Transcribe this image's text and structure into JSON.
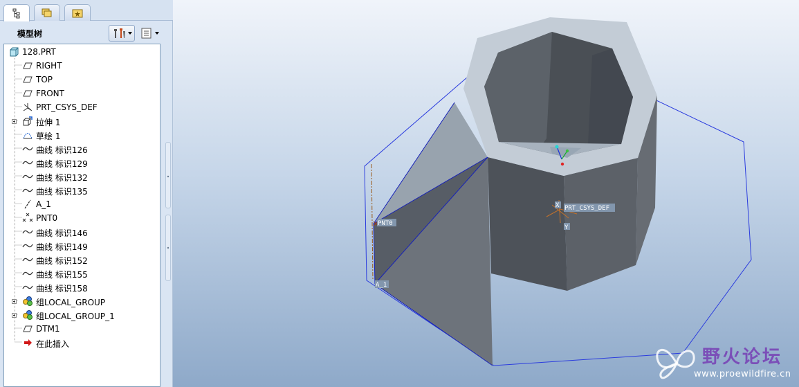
{
  "panel": {
    "title": "模型树",
    "tabs": [
      {
        "name": "model-tree-tab",
        "icon": "tree-icon"
      },
      {
        "name": "folder-browser-tab",
        "icon": "folders-icon"
      },
      {
        "name": "favorites-tab",
        "icon": "star-folder-icon"
      }
    ],
    "settings_icon": "settings-tools-icon",
    "show_icon": "show-list-icon"
  },
  "tree": {
    "root": "128.PRT",
    "items": [
      {
        "label": "RIGHT",
        "icon": "datum-plane-icon",
        "expandable": false
      },
      {
        "label": "TOP",
        "icon": "datum-plane-icon",
        "expandable": false
      },
      {
        "label": "FRONT",
        "icon": "datum-plane-icon",
        "expandable": false
      },
      {
        "label": "PRT_CSYS_DEF",
        "icon": "csys-icon",
        "expandable": false
      },
      {
        "label": "拉伸 1",
        "icon": "extrude-icon",
        "expandable": true
      },
      {
        "label": "草绘 1",
        "icon": "sketch-icon",
        "expandable": false
      },
      {
        "label": "曲线 标识126",
        "icon": "curve-icon",
        "expandable": false
      },
      {
        "label": "曲线 标识129",
        "icon": "curve-icon",
        "expandable": false
      },
      {
        "label": "曲线 标识132",
        "icon": "curve-icon",
        "expandable": false
      },
      {
        "label": "曲线 标识135",
        "icon": "curve-icon",
        "expandable": false
      },
      {
        "label": "A_1",
        "icon": "datum-axis-icon",
        "expandable": false
      },
      {
        "label": "PNT0",
        "icon": "datum-point-icon",
        "expandable": false
      },
      {
        "label": "曲线 标识146",
        "icon": "curve-icon",
        "expandable": false
      },
      {
        "label": "曲线 标识149",
        "icon": "curve-icon",
        "expandable": false
      },
      {
        "label": "曲线 标识152",
        "icon": "curve-icon",
        "expandable": false
      },
      {
        "label": "曲线 标识155",
        "icon": "curve-icon",
        "expandable": false
      },
      {
        "label": "曲线 标识158",
        "icon": "curve-icon",
        "expandable": false
      },
      {
        "label": "组LOCAL_GROUP",
        "icon": "group-icon",
        "expandable": true
      },
      {
        "label": "组LOCAL_GROUP_1",
        "icon": "group-icon",
        "expandable": true
      },
      {
        "label": "DTM1",
        "icon": "datum-plane-icon",
        "expandable": false
      },
      {
        "label": "在此插入",
        "icon": "insert-here-icon",
        "expandable": false
      }
    ]
  },
  "viewport": {
    "labels": {
      "csys": "PRT_CSYS_DEF",
      "point": "PNT0",
      "axis": "A_1",
      "csys_x": "X",
      "csys_y": "Y"
    },
    "colors": {
      "bg_top": "#f0f4fa",
      "bg_bottom": "#8ea9c9",
      "shell_face": "#5f656d",
      "rim": "#c3ccd6",
      "edge": "#1f2fd6"
    }
  },
  "watermark": {
    "title": "野火论坛",
    "url": "www.proewildfire.cn"
  }
}
